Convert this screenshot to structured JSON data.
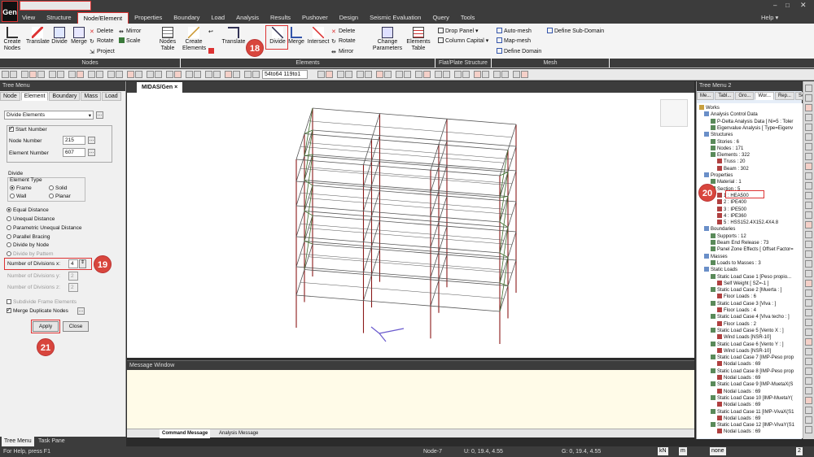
{
  "app": {
    "logo": "Gen"
  },
  "menu": [
    "View",
    "Structure",
    "Node/Element",
    "Properties",
    "Boundary",
    "Load",
    "Analysis",
    "Results",
    "Pushover",
    "Design",
    "Seismic Evaluation",
    "Query",
    "Tools"
  ],
  "help": "Help",
  "ribbon": {
    "create_nodes": "Create\nNodes",
    "translate": "Translate",
    "divide": "Divide",
    "merge": "Merge",
    "delete": "Delete",
    "rotate": "Rotate",
    "project": "Project",
    "mirror": "Mirror",
    "scale": "Scale",
    "nodes_table": "Nodes\nTable",
    "nodes_group": "Nodes",
    "create_elements": "Create\nElements",
    "translate_el": "Translate",
    "divide_el": "Divide",
    "merge_el": "Merge",
    "intersect": "Intersect",
    "delete_el": "Delete",
    "rotate_el": "Rotate",
    "mirror_el": "Mirror",
    "change_params": "Change\nParameters",
    "elements_table": "Elements\nTable",
    "elements_group": "Elements",
    "drop_panel": "Drop Panel",
    "column_capital": "Column Capital",
    "flat_group": "Flat/Plate Structure",
    "auto_mesh": "Auto-mesh",
    "map_mesh": "Map-mesh",
    "define_domain": "Define Domain",
    "define_subdomain": "Define Sub-Domain",
    "mesh_group": "Mesh"
  },
  "toolbar": {
    "selection": "54to64 119to1"
  },
  "left_panel": {
    "title": "Tree Menu",
    "tabs": [
      "Node",
      "Element",
      "Boundary",
      "Mass",
      "Load"
    ],
    "function": "Divide Elements",
    "start_number": "Start Number",
    "node_number_label": "Node Number",
    "node_number": "215",
    "element_number_label": "Element Number",
    "element_number": "607",
    "divide_label": "Divide",
    "element_type_label": "Element Type",
    "frame": "Frame",
    "solid": "Solid",
    "wall": "Wall",
    "planar": "Planar",
    "opt_equal": "Equal Distance",
    "opt_unequal": "Unequal Distance",
    "opt_param": "Parametric Unequal Distance",
    "opt_parallel": "Parallel Bracing",
    "opt_node": "Divide by Node",
    "opt_pattern": "Divide by Pattern",
    "div_x_label": "Number of Divisions x:",
    "div_x": "4",
    "div_y_label": "Number of Divisions y:",
    "div_y": "2",
    "div_z_label": "Number of Divisions z:",
    "div_z": "2",
    "subdivide": "Subdivide Frame Elements",
    "merge_dup": "Merge Duplicate Nodes",
    "apply": "Apply",
    "close": "Close",
    "bottom_tabs": [
      "Tree Menu",
      "Task Pane"
    ]
  },
  "callouts": {
    "c18": "18",
    "c19": "19",
    "c20": "20",
    "c21": "21"
  },
  "viewport": {
    "tab": "MIDAS/Gen"
  },
  "message_window": {
    "title": "Message Window",
    "tabs": [
      "Command Message",
      "Analysis Message"
    ]
  },
  "right_panel": {
    "title": "Tree Menu 2",
    "tabs": [
      "Me...",
      "Tabl...",
      "Gro...",
      "Wor...",
      "Rep...",
      "Seis..."
    ],
    "items": [
      "Works",
      "Analysis Control Data",
      "P-Delta Analysis Data [ Ni=5 : Toler",
      "Eigenvalue Analysis [ Type=Eigenv",
      "Structures",
      "Stories : 6",
      "Nodes : 171",
      "Elements : 322",
      "Truss : 20",
      "Beam : 302",
      "Properties",
      "Material : 1",
      "Section : 5",
      "1 : HEA500",
      "2 : IPE400",
      "3 : IPE500",
      "4 : IPE360",
      "5 : HSS152.4X152.4X4.8",
      "Boundaries",
      "Supports : 12",
      "Beam End Release : 73",
      "Panel Zone Effects [ Offset Factor=",
      "Masses",
      "Loads to Masses : 3",
      "Static Loads",
      "Static Load Case 1 [Peso propio...",
      "Self Weight [ SZ=-1 ]",
      "Static Load Case 2 [Muerta : ]",
      "Floor Loads : 6",
      "Static Load Case 3 [Viva : ]",
      "Floor Loads : 4",
      "Static Load Case 4 [Viva techo : ]",
      "Floor Loads : 2",
      "Static Load Case 5 [Vento X : ]",
      "Wind Loads [NSR-10]",
      "Static Load Case 6 [Vento Y : ]",
      "Wind Loads [NSR-10]",
      "Static Load Case 7 [IMP-Peso prop",
      "Nodal Loads : 69",
      "Static Load Case 8 [IMP-Peso prop",
      "Nodal Loads : 69",
      "Static Load Case 9 [IMP-MuetaX(S",
      "Nodal Loads : 69",
      "Static Load Case 10 [IMP-MuetaY(",
      "Nodal Loads : 69",
      "Static Load Case 11 [IMP-VivaX(S1",
      "Nodal Loads : 69",
      "Static Load Case 12 [IMP-VivaY(S1",
      "Nodal Loads : 69"
    ]
  },
  "status": {
    "help": "For Help, press F1",
    "node": "Node-7",
    "ucs": "U: 0, 19.4, 4.55",
    "gcs": "G: 0, 19.4, 4.55",
    "unit_force": "kN",
    "unit_len": "m",
    "misc": "none",
    "page": "2"
  },
  "colors": {
    "accent": "#d33",
    "dark": "#3c3c3c",
    "columns": "#8b1a1a",
    "beams": "#555555",
    "braces": "#3d6b2a"
  }
}
